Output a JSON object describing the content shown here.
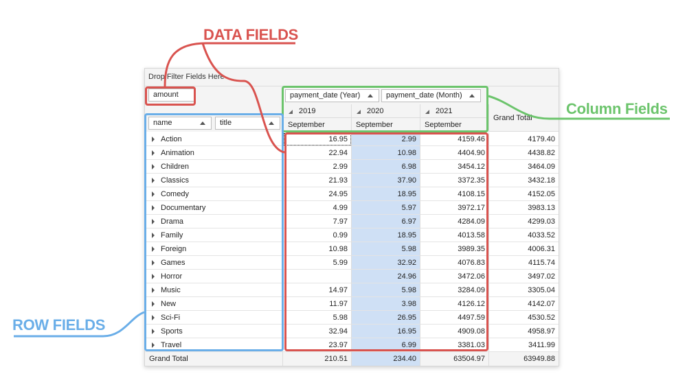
{
  "annotations": {
    "data_fields": "DATA FIELDS",
    "column_fields": "Column Fields",
    "row_fields": "ROW FIELDS"
  },
  "colors": {
    "data_red": "#d9534f",
    "column_green": "#6cc46c",
    "row_blue": "#6aaee8",
    "selection": "#cfe0f5"
  },
  "pivot": {
    "filter_placeholder": "Drop Filter Fields Here",
    "data_field": "amount",
    "column_fields": [
      "payment_date (Year)",
      "payment_date (Month)"
    ],
    "row_fields": [
      "name",
      "title"
    ],
    "years": [
      "2019",
      "2020",
      "2021"
    ],
    "months": [
      "September",
      "September",
      "September"
    ],
    "grand_total_label": "Grand Total",
    "rows": [
      {
        "name": "Action",
        "values": [
          "16.95",
          "2.99",
          "4159.46",
          "4179.40"
        ]
      },
      {
        "name": "Animation",
        "values": [
          "22.94",
          "10.98",
          "4404.90",
          "4438.82"
        ]
      },
      {
        "name": "Children",
        "values": [
          "2.99",
          "6.98",
          "3454.12",
          "3464.09"
        ]
      },
      {
        "name": "Classics",
        "values": [
          "21.93",
          "37.90",
          "3372.35",
          "3432.18"
        ]
      },
      {
        "name": "Comedy",
        "values": [
          "24.95",
          "18.95",
          "4108.15",
          "4152.05"
        ]
      },
      {
        "name": "Documentary",
        "values": [
          "4.99",
          "5.97",
          "3972.17",
          "3983.13"
        ]
      },
      {
        "name": "Drama",
        "values": [
          "7.97",
          "6.97",
          "4284.09",
          "4299.03"
        ]
      },
      {
        "name": "Family",
        "values": [
          "0.99",
          "18.95",
          "4013.58",
          "4033.52"
        ]
      },
      {
        "name": "Foreign",
        "values": [
          "10.98",
          "5.98",
          "3989.35",
          "4006.31"
        ]
      },
      {
        "name": "Games",
        "values": [
          "5.99",
          "32.92",
          "4076.83",
          "4115.74"
        ]
      },
      {
        "name": "Horror",
        "values": [
          "",
          "24.96",
          "3472.06",
          "3497.02"
        ]
      },
      {
        "name": "Music",
        "values": [
          "14.97",
          "5.98",
          "3284.09",
          "3305.04"
        ]
      },
      {
        "name": "New",
        "values": [
          "11.97",
          "3.98",
          "4126.12",
          "4142.07"
        ]
      },
      {
        "name": "Sci-Fi",
        "values": [
          "5.98",
          "26.95",
          "4497.59",
          "4530.52"
        ]
      },
      {
        "name": "Sports",
        "values": [
          "32.94",
          "16.95",
          "4909.08",
          "4958.97"
        ]
      },
      {
        "name": "Travel",
        "values": [
          "23.97",
          "6.99",
          "3381.03",
          "3411.99"
        ]
      }
    ],
    "grand_total_values": [
      "210.51",
      "234.40",
      "63504.97",
      "63949.88"
    ]
  }
}
